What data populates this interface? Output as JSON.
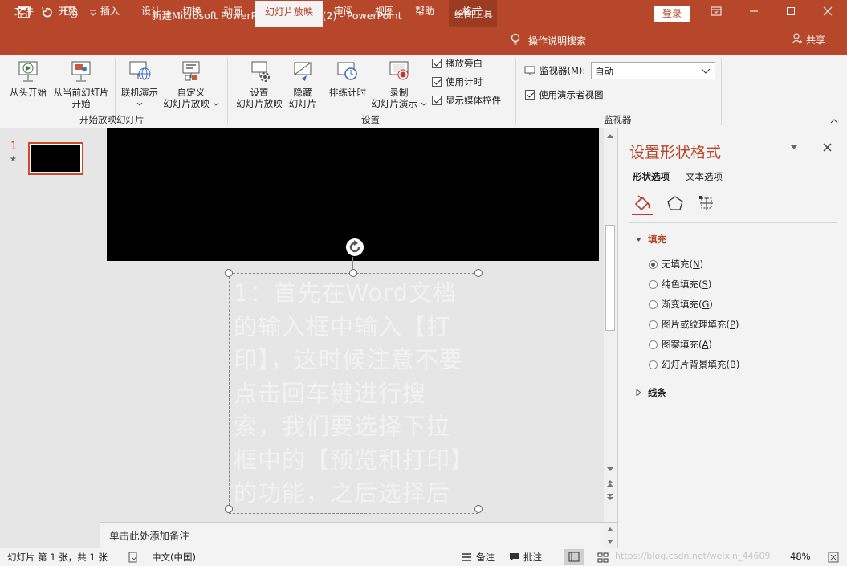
{
  "window": {
    "title": "新建Microsoft PowerPoint 演示文稿 (2)  -  PowerPoint",
    "context_group": "绘图工具",
    "login": "登录",
    "brand_color": "#b7472a"
  },
  "tabs": [
    "文件",
    "开始",
    "插入",
    "设计",
    "切换",
    "动画",
    "幻灯片放映",
    "审阅",
    "视图",
    "帮助",
    "格式"
  ],
  "active_tab": "幻灯片放映",
  "search": {
    "label": "操作说明搜索"
  },
  "share": {
    "label": "共享"
  },
  "ribbon": {
    "group1": {
      "from_start": "从头开始",
      "from_current_l1": "从当前幻灯片",
      "from_current_l2": "开始",
      "online": "联机演示",
      "custom_l1": "自定义",
      "custom_l2": "幻灯片放映",
      "label": "开始放映幻灯片"
    },
    "group2": {
      "setup_l1": "设置",
      "setup_l2": "幻灯片放映",
      "hide_l1": "隐藏",
      "hide_l2": "幻灯片",
      "rehearse": "排练计时",
      "record_l1": "录制",
      "record_l2": "幻灯片演示",
      "play_narration": "播放旁白",
      "use_timings": "使用计时",
      "show_media": "显示媒体控件",
      "label": "设置"
    },
    "group3": {
      "monitor_label": "监视器(M):",
      "monitor_value": "自动",
      "presenter_view": "使用演示者视图",
      "label": "监视器"
    }
  },
  "thumbnails": {
    "slide_number": "1",
    "star": "★"
  },
  "slide": {
    "textbox_text": "1：首先在Word文档的输入框中输入【打印】，这时候注意不要点击回车键进行搜索，我们要选择下拉框中的【预览和打印】的功能，之后选择后"
  },
  "notes": {
    "placeholder": "单击此处添加备注"
  },
  "format_pane": {
    "title": "设置形状格式",
    "tab_shape": "形状选项",
    "tab_text": "文本选项",
    "fill_section": "填充",
    "options": [
      {
        "label": "无填充(",
        "key": "N",
        "tail": ")",
        "selected": true
      },
      {
        "label": "纯色填充(",
        "key": "S",
        "tail": ")",
        "selected": false
      },
      {
        "label": "渐变填充(",
        "key": "G",
        "tail": ")",
        "selected": false
      },
      {
        "label": "图片或纹理填充(",
        "key": "P",
        "tail": ")",
        "selected": false
      },
      {
        "label": "图案填充(",
        "key": "A",
        "tail": ")",
        "selected": false
      },
      {
        "label": "幻灯片背景填充(",
        "key": "B",
        "tail": ")",
        "selected": false
      }
    ],
    "line_section": "线条"
  },
  "status": {
    "slide_info": "幻灯片 第 1 张，共 1 张",
    "language": "中文(中国)",
    "notes": "备注",
    "comments": "批注",
    "zoom": "48%",
    "watermark": "https://blog.csdn.net/weixin_44609"
  }
}
